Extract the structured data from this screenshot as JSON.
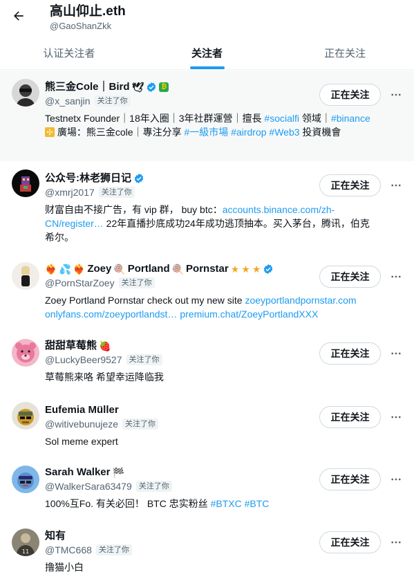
{
  "header": {
    "title": "高山仰止.eth",
    "handle": "@GaoShanZkk"
  },
  "tabs": [
    {
      "label": "认证关注者"
    },
    {
      "label": "关注者"
    },
    {
      "label": "正在关注"
    }
  ],
  "follow_label": "正在关注",
  "follows_you": "关注了你",
  "users": [
    {
      "name": "熊三金Cole｜Bird",
      "handle": "@x_sanjin",
      "bio_a": "Testnetx Founder｜18年入圈｜3年社群運營｜擅長 ",
      "bio_link1": "#socialfi",
      "bio_b": " 领域｜",
      "bio_link2": "#binance",
      "bio_c": " 廣場：熊三金cole｜專注分享 ",
      "bio_link3": "#一級市場",
      "bio_link4": "#airdrop",
      "bio_link5": "#Web3",
      "bio_d": " 投資機會"
    },
    {
      "name": "公众号:林老狮日记",
      "handle": "@xmrj2017",
      "bio_a": "财富自由不接广告，有 vip 群， buy btc：",
      "bio_link1": "accounts.binance.com/zh-CN/register…",
      "bio_b": " 22年直播抄底成功24年成功逃顶抽本。买入茅台，腾讯，伯克希尔。"
    },
    {
      "name": "Zoey",
      "name2": "Portland",
      "name3": "Pornstar",
      "handle": "@PornStarZoey",
      "bio_a": "Zoey Portland Pornstar check out my new site ",
      "bio_link1": "zoeyportlandpornstar.com",
      "bio_link2": "onlyfans.com/zoeyportlandst…",
      "bio_link3": "premium.chat/ZoeyPortlandXXX"
    },
    {
      "name": "甜甜草莓熊",
      "handle": "@LuckyBeer9527",
      "bio_a": "草莓熊来咯 希望幸运降临我"
    },
    {
      "name": "Eufemia Müller",
      "handle": "@witivebunujeze",
      "bio_a": "Sol meme expert"
    },
    {
      "name": "Sarah Walker",
      "handle": "@WalkerSara63479",
      "bio_a": "100%互Fo. 有关必回！ BTC 忠实粉丝 ",
      "bio_link1": "#BTXC",
      "bio_link2": "#BTC"
    },
    {
      "name": "知有",
      "handle": "@TMC668",
      "bio_a": "撸猫小白"
    }
  ],
  "icons": {
    "back": "back-arrow-icon",
    "more": "more-horizontal-icon",
    "verified": "verified-badge-icon"
  },
  "colors": {
    "accent": "#1d9bf0",
    "text": "#0f1419",
    "muted": "#536471"
  }
}
